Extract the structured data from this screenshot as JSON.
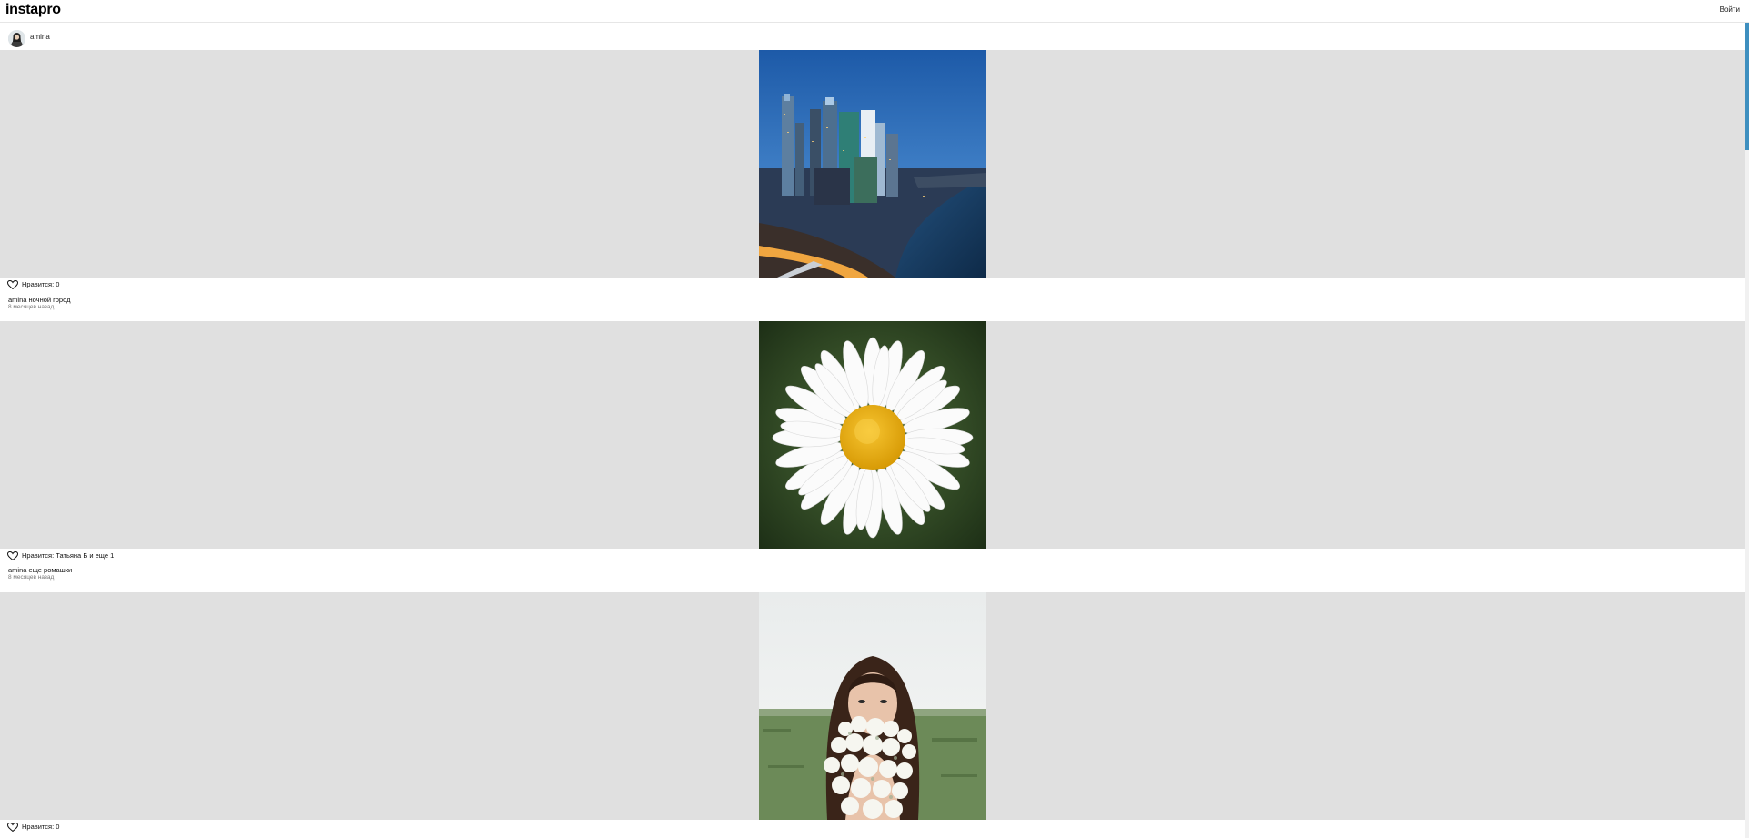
{
  "header": {
    "logo": "instapro",
    "login_label": "Войти"
  },
  "user": {
    "username": "amina"
  },
  "posts": [
    {
      "image_subject": "night city skyline",
      "likes_text": "Нравится: 0",
      "author": "amina",
      "caption": "ночной город",
      "time_ago": "8 месяцев назад"
    },
    {
      "image_subject": "chamomile flower",
      "likes_text": "Нравится: Татьяна Б и еще 1",
      "author": "amina",
      "caption": "еще ромашки",
      "time_ago": "8 месяцев назад"
    },
    {
      "image_subject": "woman with white flower bouquet",
      "likes_text": "Нравится: 0"
    }
  ],
  "colors": {
    "image_background": "#e0e0e0",
    "time_text": "#777777",
    "scroll_thumb": "#3e8fbf"
  }
}
